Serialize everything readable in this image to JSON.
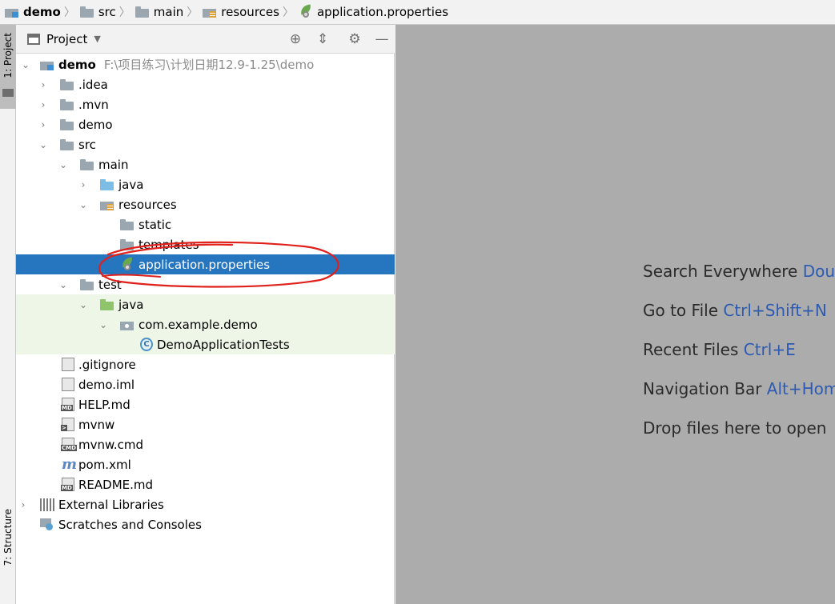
{
  "breadcrumb": {
    "items": [
      {
        "label": "demo",
        "icon": "module-folder-icon",
        "bold": true
      },
      {
        "label": "src",
        "icon": "folder-icon"
      },
      {
        "label": "main",
        "icon": "folder-icon"
      },
      {
        "label": "resources",
        "icon": "resources-folder-icon"
      },
      {
        "label": "application.properties",
        "icon": "spring-properties-icon"
      }
    ]
  },
  "stripe": {
    "project_label": "1: Project",
    "structure_label": "7: Structure"
  },
  "panel": {
    "title": "Project",
    "dropdown_glyph": "▼",
    "actions": {
      "locate": "⊕",
      "collapse": "⇕",
      "settings": "⚙",
      "hide": "—"
    }
  },
  "tree": {
    "root_name": "demo",
    "root_path": "F:\\项目练习\\计划日期12.9-1.25\\demo",
    "idea": ".idea",
    "mvn": ".mvn",
    "demo": "demo",
    "src": "src",
    "main": "main",
    "java": "java",
    "resources": "resources",
    "static": "static",
    "templates": "templates",
    "application_properties": "application.properties",
    "test": "test",
    "test_java": "java",
    "package": "com.example.demo",
    "test_class": "DemoApplicationTests",
    "gitignore": ".gitignore",
    "demo_iml": "demo.iml",
    "help_md": "HELP.md",
    "mvnw": "mvnw",
    "mvnw_cmd": "mvnw.cmd",
    "pom_xml": "pom.xml",
    "readme_md": "README.md",
    "external_libraries": "External Libraries",
    "scratches": "Scratches and Consoles"
  },
  "file_tags": {
    "md": "MD",
    "cmd": "CMD",
    "mvnw": ">",
    "pom": "m",
    "test_class": "C"
  },
  "editor_hints": [
    {
      "label": "Search Everywhere",
      "shortcut": "Double Shift"
    },
    {
      "label": "Go to File",
      "shortcut": "Ctrl+Shift+N"
    },
    {
      "label": "Recent Files",
      "shortcut": "Ctrl+E"
    },
    {
      "label": "Navigation Bar",
      "shortcut": "Alt+Home"
    },
    {
      "label": "Drop files here to open",
      "shortcut": ""
    }
  ],
  "colors": {
    "selection": "#2675bf",
    "test_background": "#eef6e8",
    "annotation": "#e0201b",
    "shortcut": "#2d5bb3"
  }
}
